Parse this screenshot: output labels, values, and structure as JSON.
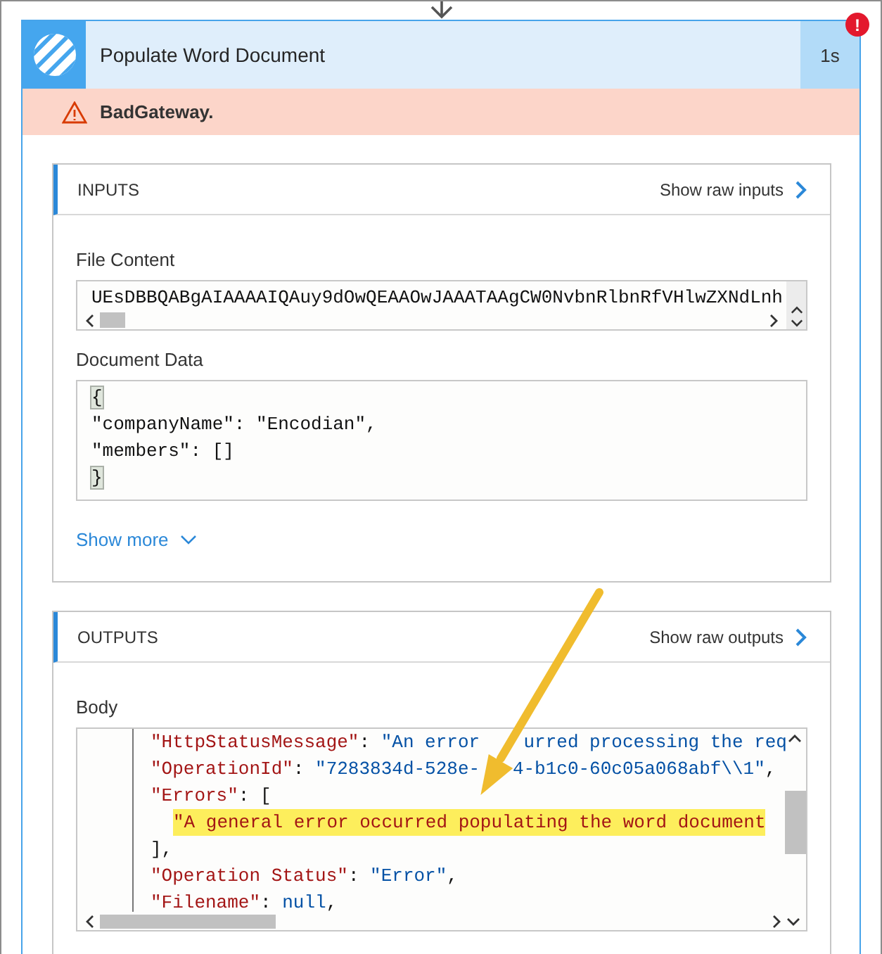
{
  "action": {
    "title": "Populate Word Document",
    "duration": "1s",
    "failed": true,
    "badge": "!"
  },
  "error_message": "BadGateway.",
  "inputs": {
    "heading": "INPUTS",
    "raw_link": "Show raw inputs",
    "fields": [
      {
        "label": "File Content",
        "kind": "single_line",
        "lines": [
          {
            "matched": false,
            "text": "UEsDBBQABgAIAAAAIQAuy9dOwQEAAOwJAAATAAgCW0NvbnRlbnRfVHlwZXNdLnh"
          }
        ]
      },
      {
        "label": "Document Data",
        "kind": "multi_line",
        "lines": [
          {
            "matched": true,
            "text": "{"
          },
          {
            "matched": false,
            "text": "\"companyName\": \"Encodian\","
          },
          {
            "matched": false,
            "text": "\"members\": []"
          },
          {
            "matched": true,
            "text": "}"
          }
        ]
      }
    ],
    "show_more": "Show more"
  },
  "outputs": {
    "heading": "OUTPUTS",
    "raw_link": "Show raw outputs",
    "body": {
      "label": "Body",
      "lines": [
        {
          "nested": false,
          "highlighted": false,
          "tokens": [
            {
              "kind": "key",
              "text": "\"HttpStatusMessage\""
            },
            {
              "kind": "punct",
              "text": ": "
            },
            {
              "kind": "str",
              "text": "\"An error "
            },
            {
              "kind": "gap"
            },
            {
              "kind": "str",
              "text": "urred processing the req"
            }
          ]
        },
        {
          "nested": false,
          "highlighted": false,
          "tokens": [
            {
              "kind": "key",
              "text": "\"OperationId\""
            },
            {
              "kind": "punct",
              "text": ": "
            },
            {
              "kind": "str",
              "text": "\"7283834d-528e-"
            },
            {
              "kind": "gap"
            },
            {
              "kind": "str",
              "text": "4-b1c0-60c05a068abf\\\\1\""
            },
            {
              "kind": "punct",
              "text": ","
            }
          ]
        },
        {
          "nested": false,
          "highlighted": false,
          "tokens": [
            {
              "kind": "key",
              "text": "\"Errors\""
            },
            {
              "kind": "punct",
              "text": ": ["
            }
          ]
        },
        {
          "nested": true,
          "highlighted": true,
          "tokens": [
            {
              "kind": "item",
              "text": "\"A general error occurred populating the word document"
            }
          ]
        },
        {
          "nested": false,
          "highlighted": false,
          "tokens": [
            {
              "kind": "punct",
              "text": "],"
            }
          ]
        },
        {
          "nested": false,
          "highlighted": false,
          "tokens": [
            {
              "kind": "key",
              "text": "\"Operation Status\""
            },
            {
              "kind": "punct",
              "text": ": "
            },
            {
              "kind": "str",
              "text": "\"Error\""
            },
            {
              "kind": "punct",
              "text": ","
            }
          ]
        },
        {
          "nested": false,
          "highlighted": false,
          "tokens": [
            {
              "kind": "key",
              "text": "\"Filename\""
            },
            {
              "kind": "punct",
              "text": ": "
            },
            {
              "kind": "str",
              "text": "null"
            },
            {
              "kind": "punct",
              "text": ","
            }
          ]
        }
      ]
    }
  }
}
